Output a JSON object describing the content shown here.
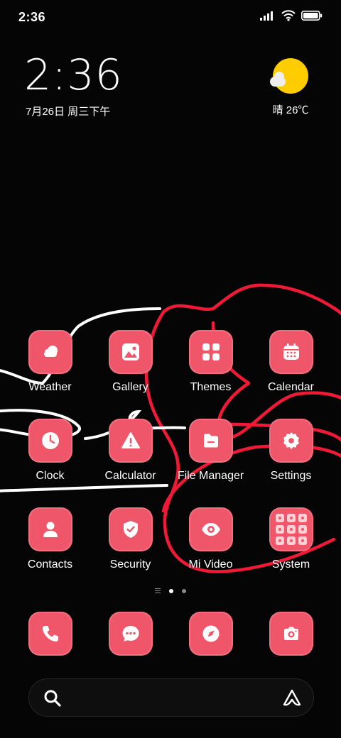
{
  "status_bar": {
    "time": "2:36",
    "icons": [
      "signal-icon",
      "wifi-icon",
      "battery-icon"
    ]
  },
  "clock_widget": {
    "time": "2:36",
    "date": "7月26日 周三下午"
  },
  "weather_widget": {
    "icon": "sun-cloud-icon",
    "text": "晴 26℃"
  },
  "apps": [
    {
      "label": "Weather",
      "icon": "weather-icon"
    },
    {
      "label": "Gallery",
      "icon": "gallery-icon"
    },
    {
      "label": "Themes",
      "icon": "themes-icon"
    },
    {
      "label": "Calendar",
      "icon": "calendar-icon"
    },
    {
      "label": "Clock",
      "icon": "clock-icon"
    },
    {
      "label": "Calculator",
      "icon": "warning-icon"
    },
    {
      "label": "File Manager",
      "icon": "folder-icon"
    },
    {
      "label": "Settings",
      "icon": "gear-icon"
    },
    {
      "label": "Contacts",
      "icon": "contacts-icon"
    },
    {
      "label": "Security",
      "icon": "shield-icon"
    },
    {
      "label": "Mi Video",
      "icon": "eye-icon"
    },
    {
      "label": "System",
      "icon": "folder-grid-icon"
    }
  ],
  "page_indicator": {
    "pages": 2,
    "active": 1
  },
  "dock": [
    {
      "icon": "phone-icon"
    },
    {
      "icon": "message-icon"
    },
    {
      "icon": "compass-icon"
    },
    {
      "icon": "camera-icon"
    }
  ],
  "colors": {
    "icon_bg": "#f0566a",
    "wallpaper_red": "#ff1a3a",
    "sun": "#ffcc00"
  }
}
